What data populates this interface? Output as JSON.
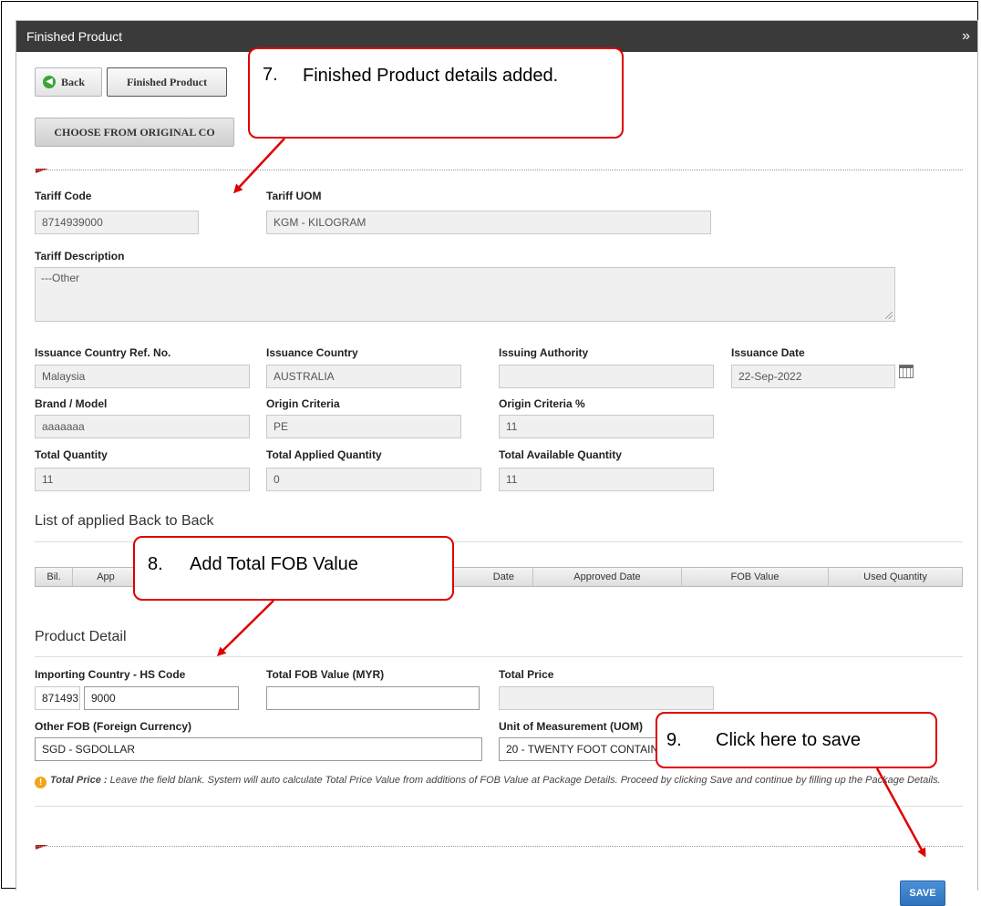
{
  "panel": {
    "title": "Finished Product",
    "collapse_icon": "double-chevron-down-icon"
  },
  "toolbar": {
    "back_label": "Back",
    "finished_product_label": "Finished Product",
    "choose_label": "CHOOSE FROM ORIGINAL CO"
  },
  "tariff": {
    "code_label": "Tariff Code",
    "code_value": "8714939000",
    "uom_label": "Tariff UOM",
    "uom_value": "KGM - KILOGRAM",
    "desc_label": "Tariff Description",
    "desc_value": "---Other"
  },
  "issuance": {
    "ref_label": "Issuance Country Ref. No.",
    "ref_value": "Malaysia",
    "country_label": "Issuance Country",
    "country_value": "AUSTRALIA",
    "authority_label": "Issuing Authority",
    "authority_value": "",
    "date_label": "Issuance Date",
    "date_value": "22-Sep-2022"
  },
  "product": {
    "brand_label": "Brand / Model",
    "brand_value": "aaaaaaa",
    "origin_label": "Origin Criteria",
    "origin_value": "PE",
    "origin_pct_label": "Origin Criteria %",
    "origin_pct_value": "11"
  },
  "quantity": {
    "total_label": "Total Quantity",
    "total_value": "11",
    "applied_label": "Total Applied Quantity",
    "applied_value": "0",
    "available_label": "Total Available Quantity",
    "available_value": "11"
  },
  "b2b": {
    "title": "List of applied Back to Back",
    "columns": [
      "Bil.",
      "App",
      "Date",
      "Approved Date",
      "FOB Value",
      "Used Quantity"
    ]
  },
  "detail": {
    "title": "Product Detail",
    "hs_label": "Importing Country - HS Code",
    "hs_prefix": "871493",
    "hs_suffix": "9000",
    "fob_label": "Total FOB Value (MYR)",
    "fob_value": "",
    "price_label": "Total Price",
    "price_value": "",
    "other_fob_label": "Other FOB (Foreign Currency)",
    "other_fob_value": "SGD - SGDOLLAR",
    "uom_label": "Unit of Measurement (UOM)",
    "uom_value": "20 - TWENTY FOOT CONTAINER"
  },
  "note": {
    "label": "Total Price :",
    "text": " Leave the field blank. System will auto calculate Total Price Value from additions of FOB Value at Package Details. Proceed by clicking Save and continue by filling up the Package Details."
  },
  "save_label": "SAVE",
  "callouts": {
    "c7_num": "7.",
    "c7_text": "Finished Product details added.",
    "c8_num": "8.",
    "c8_text": "Add Total FOB Value",
    "c9_num": "9.",
    "c9_text": "Click here to save"
  },
  "colors": {
    "header_bg": "#3a3a3a",
    "callout_border": "#e00000",
    "save_bg": "#2f72bd"
  }
}
